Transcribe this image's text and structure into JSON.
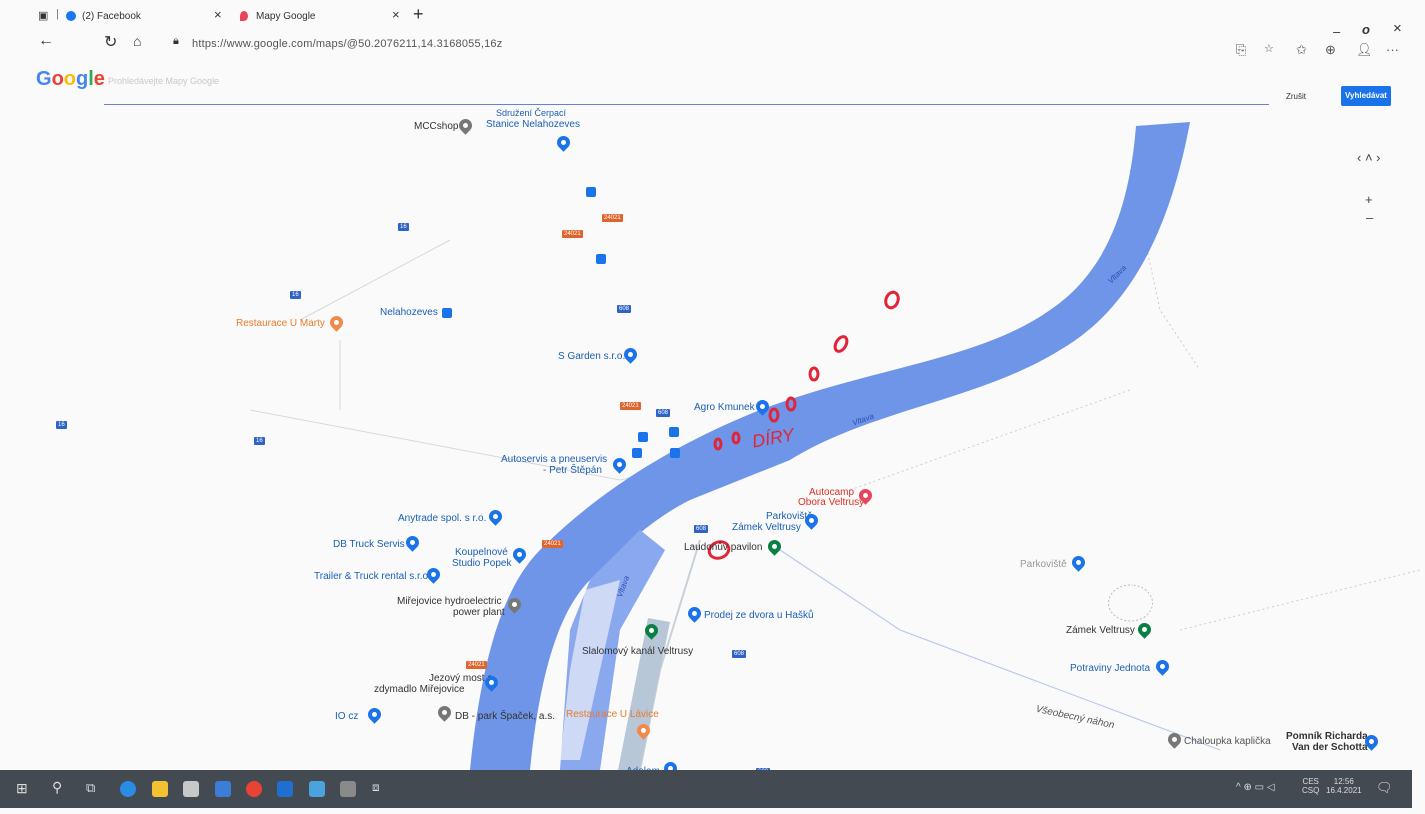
{
  "browser": {
    "tabs": [
      {
        "label": "(2) Facebook",
        "close": "×"
      },
      {
        "label": "Mapy Google",
        "close": "×"
      }
    ],
    "new_tab": "+",
    "url": "https://www.google.com/maps/@50.2076211,14.3168055,16z",
    "window_controls": {
      "minimize": "–",
      "restore": "◻",
      "close": "×"
    },
    "more": "···"
  },
  "maps": {
    "logo": "Google",
    "search_placeholder": "Prohledávejte Mapy Google",
    "share_label": "Zrušit",
    "signin_label": "Vyhledávat",
    "zoom_in": "+",
    "zoom_out": "–",
    "pan": "‹ ˄ ›"
  },
  "map_labels": {
    "mcc_shop": "MCCshop",
    "cerpaci1": "Sdružení Čerpací",
    "cerpaci2": "Stanice Nelahozeves",
    "restaurace_u_marty": "Restaurace U Marty",
    "nelahozeves": "Nelahozeves",
    "s_garden": "S Garden s.r.o.",
    "agro_kmunek": "Agro Kmunek",
    "autoservis1": "Autoservis a pneuservis",
    "autoservis2": "- Petr Štěpán",
    "autocamp1": "Autocamp",
    "autocamp2": "Obora Veltrusy",
    "parkoviste_zamek1": "Parkoviště",
    "parkoviste_zamek2": "Zámek Veltrusy",
    "laudonuv": "Laudonův pavilon",
    "anytrade": "Anytrade spol. s r.o.",
    "db_truck": "DB Truck Servis",
    "koupelnove1": "Koupelnové",
    "koupelnove2": "Studio Popek",
    "trailer": "Trailer & Truck rental s.r.o.",
    "hydro1": "Miřejovice hydroelectric",
    "hydro2": "power plant",
    "prodej": "Prodej ze dvora u Hašků",
    "slalom": "Slalomový kanál Veltrusy",
    "jezovy1": "Jezový most a",
    "jezovy2": "zdymadlo Miřejovice",
    "io": "IO cz",
    "db_park": "DB - park Špaček, a.s.",
    "restaurace_lavice": "Restaurace U Lávice",
    "adelam": "Adelam",
    "parkoviste": "Parkoviště",
    "zamek_veltrusy": "Zámek Veltrusy",
    "potraviny": "Potraviny Jednota",
    "vseobecny": "Všeobecný náhon",
    "chaloupka": "Chaloupka kaplička",
    "pomnik1": "Pomník Richarda",
    "pomnik2": "Van der Schotta",
    "vltava1": "Vltava",
    "vltava2": "Vltava",
    "vltava3": "Vltava",
    "handwritten": "DÍRY",
    "route_16a": "16",
    "route_16b": "16",
    "route_16c": "16",
    "route_16d": "16",
    "route_608a": "608",
    "route_608b": "608",
    "route_608c": "608",
    "route_608d": "608",
    "route_608e": "608",
    "road_240a": "24021",
    "road_240b": "24021",
    "road_240c": "24021",
    "road_240d": "24021",
    "road_240e": "24021"
  },
  "taskbar": {
    "clock_time": "12:56",
    "clock_date": "16.4.2021",
    "lang1": "CES",
    "lang2": "CSQ"
  },
  "colors": {
    "river": "#6f95e8",
    "accent": "#1a73e8",
    "annotation": "#e0253a",
    "taskbar": "#444a52"
  }
}
